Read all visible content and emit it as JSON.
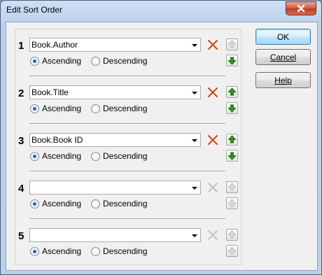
{
  "window": {
    "title": "Edit Sort Order"
  },
  "buttons": {
    "ok": "OK",
    "cancel": "Cancel",
    "help": "Help"
  },
  "sort_rows": [
    {
      "index": "1",
      "field": "Book.Author",
      "ascending_label": "Ascending",
      "descending_label": "Descending",
      "order": "ascending",
      "delete_enabled": true,
      "up_enabled": false,
      "down_enabled": true
    },
    {
      "index": "2",
      "field": "Book.Title",
      "ascending_label": "Ascending",
      "descending_label": "Descending",
      "order": "ascending",
      "delete_enabled": true,
      "up_enabled": true,
      "down_enabled": true
    },
    {
      "index": "3",
      "field": "Book.Book ID",
      "ascending_label": "Ascending",
      "descending_label": "Descending",
      "order": "ascending",
      "delete_enabled": true,
      "up_enabled": true,
      "down_enabled": true
    },
    {
      "index": "4",
      "field": "",
      "ascending_label": "Ascending",
      "descending_label": "Descending",
      "order": "ascending",
      "delete_enabled": false,
      "up_enabled": false,
      "down_enabled": false
    },
    {
      "index": "5",
      "field": "",
      "ascending_label": "Ascending",
      "descending_label": "Descending",
      "order": "ascending",
      "delete_enabled": false,
      "up_enabled": false,
      "down_enabled": false
    }
  ],
  "colors": {
    "delete_active": "#d4431b",
    "disabled": "#b9b9b9",
    "arrow_active": "#2e9a1b"
  }
}
